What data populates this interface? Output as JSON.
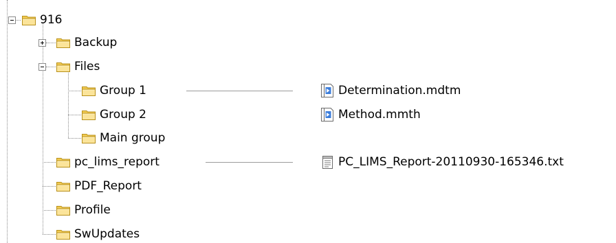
{
  "tree": {
    "root": {
      "label": "916",
      "expanded": true
    },
    "nodes": [
      {
        "id": "backup",
        "label": "Backup",
        "expanded": false
      },
      {
        "id": "files",
        "label": "Files",
        "expanded": true,
        "children": [
          {
            "id": "group1",
            "label": "Group 1"
          },
          {
            "id": "group2",
            "label": "Group 2"
          },
          {
            "id": "maingroup",
            "label": "Main group"
          }
        ]
      },
      {
        "id": "pc_lims_report",
        "label": "pc_lims_report"
      },
      {
        "id": "pdf_report",
        "label": "PDF_Report"
      },
      {
        "id": "profile",
        "label": "Profile"
      },
      {
        "id": "swupdates",
        "label": "SwUpdates"
      }
    ]
  },
  "files": {
    "group1_files": [
      {
        "label": "Determination.mdtm",
        "icon": "method-file-icon"
      },
      {
        "label": "Method.mmth",
        "icon": "method-file-icon"
      }
    ],
    "report_files": [
      {
        "label": "PC_LIMS_Report-20110930-165346.txt",
        "icon": "text-file-icon"
      }
    ]
  },
  "colors": {
    "folder_fill": "#F5D66E",
    "folder_stroke": "#B8901A",
    "tree_line": "#8A8A8A",
    "method_icon_blue": "#3D7EDB"
  }
}
